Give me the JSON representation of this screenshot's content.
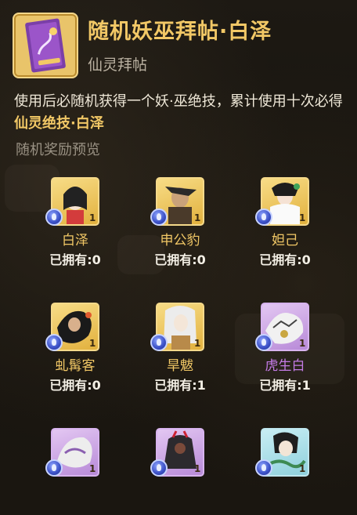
{
  "header": {
    "title": "随机妖巫拜帖·白泽",
    "type_label": "仙灵拜帖",
    "icon": "purple-invitation-scroll-icon"
  },
  "description": {
    "text_before": "使用后必随机获得一个妖·巫绝技，累计使用十次必得",
    "highlight": "仙灵绝技·白泽"
  },
  "preview_title": "随机奖励预览",
  "rewards": [
    {
      "name": "白泽",
      "owned": "已拥有:0",
      "count": "1",
      "rarity": "gold"
    },
    {
      "name": "申公豹",
      "owned": "已拥有:0",
      "count": "1",
      "rarity": "gold"
    },
    {
      "name": "妲己",
      "owned": "已拥有:0",
      "count": "1",
      "rarity": "gold"
    },
    {
      "name": "虬髯客",
      "owned": "已拥有:0",
      "count": "1",
      "rarity": "gold"
    },
    {
      "name": "旱魃",
      "owned": "已拥有:1",
      "count": "1",
      "rarity": "gold"
    },
    {
      "name": "虎生白",
      "owned": "已拥有:1",
      "count": "1",
      "rarity": "purple"
    },
    {
      "name": "",
      "owned": "",
      "count": "1",
      "rarity": "purple"
    },
    {
      "name": "",
      "owned": "",
      "count": "1",
      "rarity": "purple"
    },
    {
      "name": "",
      "owned": "",
      "count": "1",
      "rarity": "blue"
    }
  ],
  "colors": {
    "gold_text": "#f2c866",
    "purple_text": "#c47be6",
    "background": "#17140f"
  }
}
